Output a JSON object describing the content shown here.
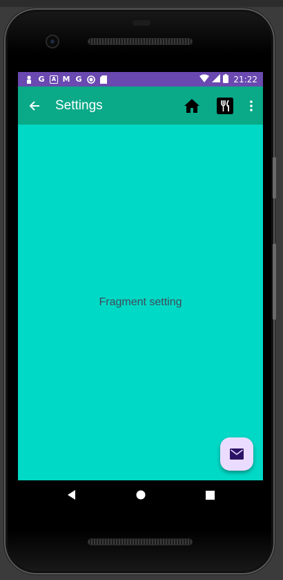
{
  "status_bar": {
    "time": "21:22",
    "notification_icons": [
      "person-icon",
      "google-icon",
      "a-icon",
      "gmail-icon",
      "google-icon",
      "circle-icon",
      "sd-card-icon"
    ],
    "notification_glyphs": [
      "",
      "G",
      "A",
      "M",
      "G",
      "",
      ""
    ]
  },
  "app_bar": {
    "title": "Settings",
    "background": "#0aa988",
    "actions": [
      "home-icon",
      "restaurant-icon",
      "overflow-menu-icon"
    ]
  },
  "content": {
    "text": "Fragment setting",
    "background": "#00d9c6"
  },
  "fab": {
    "icon": "mail-icon",
    "background": "#eadcff"
  },
  "colors": {
    "status_bar": "#6a49b0",
    "text": "#404a5a"
  }
}
